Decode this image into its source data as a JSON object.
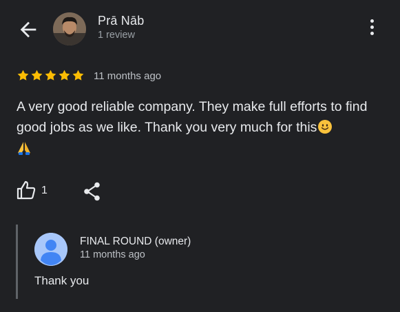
{
  "header": {
    "back_icon": "arrow-left-icon",
    "reviewer_name": "Prā Nāb",
    "reviewer_count": "1 review",
    "more_icon": "more-vert-icon"
  },
  "review": {
    "rating": 5,
    "rating_max": 5,
    "star_color": "#fbbc04",
    "time": "11 months ago",
    "text": "A very good reliable company. They make full efforts to find good jobs as we like. Thank you very much for this",
    "emoji": [
      "slightly-smiling-face",
      "folded-hands"
    ]
  },
  "actions": {
    "like_icon": "thumb-up-icon",
    "like_count": "1",
    "share_icon": "share-icon"
  },
  "owner_reply": {
    "name": "FINAL ROUND (owner)",
    "time": "11 months ago",
    "text": "Thank you",
    "avatar_color": "#a8c7fa"
  }
}
